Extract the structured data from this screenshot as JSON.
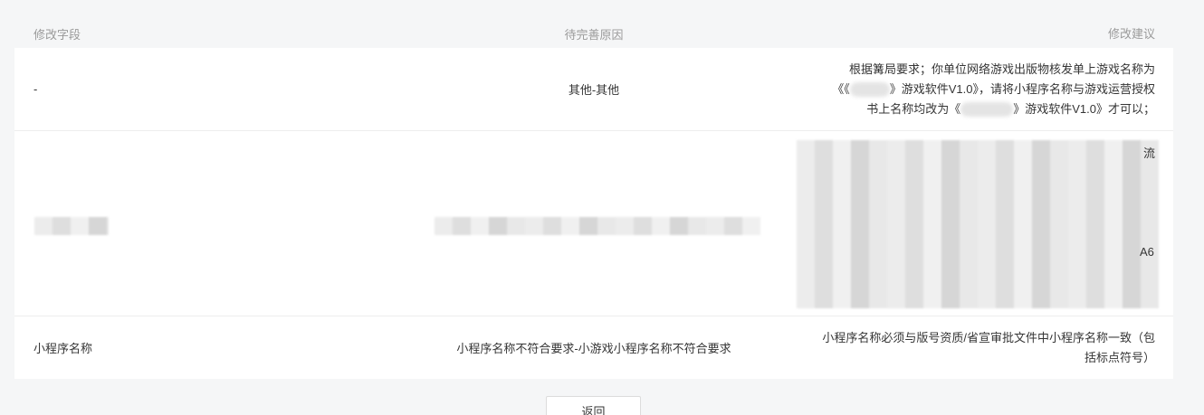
{
  "table": {
    "headers": {
      "field": "修改字段",
      "reason": "待完善原因",
      "suggestion": "修改建议"
    },
    "rows": [
      {
        "field": "-",
        "reason": "其他-其他",
        "suggestion_lines": [
          "根据篝局要求；你单位网络游戏出版物核发单上游戏名称为",
          "《《",
          "》游戏软件V1.0》，请将小程序名称与游戏运营授权",
          "书上名称均改为《",
          "》游戏软件V1.0》才可以；"
        ]
      },
      {
        "suggestion_fragments": [
          "流",
          "A6"
        ]
      },
      {
        "field": "小程序名称",
        "reason": "小程序名称不符合要求-小游戏小程序名称不符合要求",
        "suggestion_lines": [
          "小程序名称必须与版号资质/省宣审批文件中小程序名称一致（包",
          "括标点符号）"
        ]
      }
    ]
  },
  "footer": {
    "return_label": "返回"
  }
}
